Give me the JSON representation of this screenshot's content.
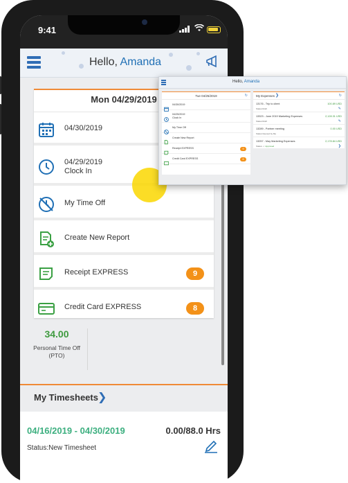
{
  "status_bar": {
    "time": "9:41"
  },
  "header": {
    "greeting": "Hello,",
    "user_name": "Amanda"
  },
  "date_card": {
    "date": "Mon 04/29/2019",
    "items": [
      {
        "icon": "calendar-icon",
        "line1": "04/30/2019",
        "line2": ""
      },
      {
        "icon": "clock-icon",
        "line1": "04/29/2019",
        "line2": "Clock In"
      },
      {
        "icon": "time-off-icon",
        "line1": "My Time Off",
        "line2": ""
      },
      {
        "icon": "new-report-icon",
        "line1": "Create New Report",
        "line2": ""
      },
      {
        "icon": "receipt-icon",
        "line1": "Receipt EXPRESS",
        "line2": "",
        "badge": "9"
      },
      {
        "icon": "credit-card-icon",
        "line1": "Credit Card EXPRESS",
        "line2": "",
        "badge": "8"
      }
    ]
  },
  "pto": {
    "value": "34.00",
    "label_line1": "Personal Time Off",
    "label_line2": "(PTO)"
  },
  "timesheets": {
    "title": "My Timesheets",
    "range": "04/16/2019 - 04/30/2019",
    "hours": "0.00/88.0 Hrs",
    "status": "Status:New Timesheet"
  },
  "tablet": {
    "greeting": "Hello,",
    "user_name": "Amanda",
    "date": "Tue 04/25/2019",
    "items": [
      {
        "line1": "04/30/2019",
        "line2": ""
      },
      {
        "line1": "04/25/2019",
        "line2": "Clock In"
      },
      {
        "line1": "My Time Off",
        "line2": ""
      },
      {
        "line1": "Create New Report",
        "line2": ""
      },
      {
        "line1": "Receipt EXPRESS",
        "line2": "",
        "badge": "9"
      },
      {
        "line1": "Credit Card EXPRESS",
        "line2": "",
        "badge": "8"
      }
    ],
    "expenses_title": "My Expenses",
    "expenses": [
      {
        "name": "13176 - Trip to client",
        "amount": "100.89 USD",
        "status": "Status:Draft"
      },
      {
        "name": "13323 - June 2019 Marketing Expenses",
        "amount": "2,128.31 USD",
        "status": "Status:Draft"
      },
      {
        "name": "13289 - Partner meeting",
        "amount": "0.00 USD",
        "status": "Status:Opened by Me"
      },
      {
        "name": "13257 - May Marketing Expenses",
        "amount": "2,178.84 USD",
        "status": "Status:",
        "approved": "Approved"
      }
    ]
  },
  "colors": {
    "accent": "#f08a36",
    "brand": "#2f6db5",
    "badge": "#f39118",
    "green": "#3e9a3e"
  }
}
